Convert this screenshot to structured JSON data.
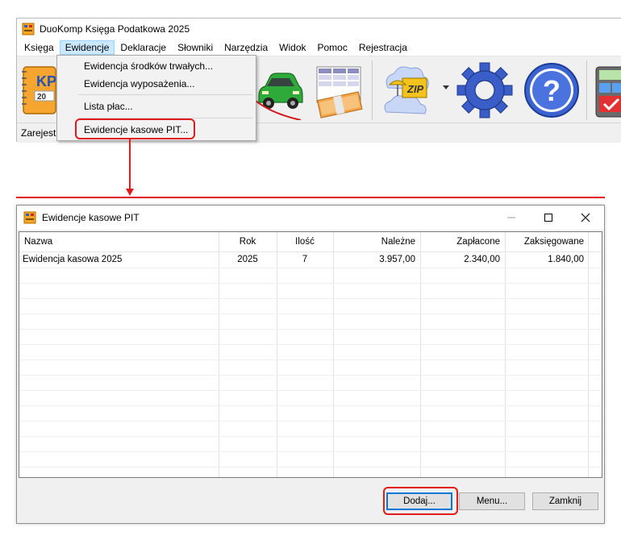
{
  "app": {
    "title": "DuoKomp Księga Podatkowa 2025",
    "menu": [
      "Księga",
      "Ewidencje",
      "Deklaracje",
      "Słowniki",
      "Narzędzia",
      "Widok",
      "Pomoc",
      "Rejestracja"
    ],
    "active_menu_index": 1,
    "toolbar_icons": [
      "kpir-book-icon",
      "car-icon",
      "money-table-icon",
      "zip-backup-icon",
      "settings-gear-icon",
      "help-icon",
      "calculator-icon"
    ],
    "book_icon_text": "KP",
    "book_icon_sub": "20",
    "zip_label": "ZIP",
    "status_text": "Zarejestr"
  },
  "dropdown": {
    "items": [
      "Ewidencja środków trwałych...",
      "Ewidencja wyposażenia...",
      "Lista płac...",
      "Ewidencje kasowe PIT..."
    ],
    "highlighted_index": 3
  },
  "dialog": {
    "title": "Ewidencje kasowe PIT",
    "columns": [
      "Nazwa",
      "Rok",
      "Ilość",
      "Należne",
      "Zapłacone",
      "Zaksięgowane"
    ],
    "rows": [
      {
        "nazwa": "Ewidencja kasowa 2025",
        "rok": "2025",
        "ilosc": "7",
        "nalezne": "3.957,00",
        "zaplacone": "2.340,00",
        "zaksiegowane": "1.840,00"
      }
    ],
    "buttons": {
      "add": "Dodaj...",
      "menu": "Menu...",
      "close": "Zamknij"
    }
  },
  "colors": {
    "highlight_red": "#e11b1b",
    "menu_active_bg": "#cce8ff",
    "default_button_border": "#0078d7"
  }
}
